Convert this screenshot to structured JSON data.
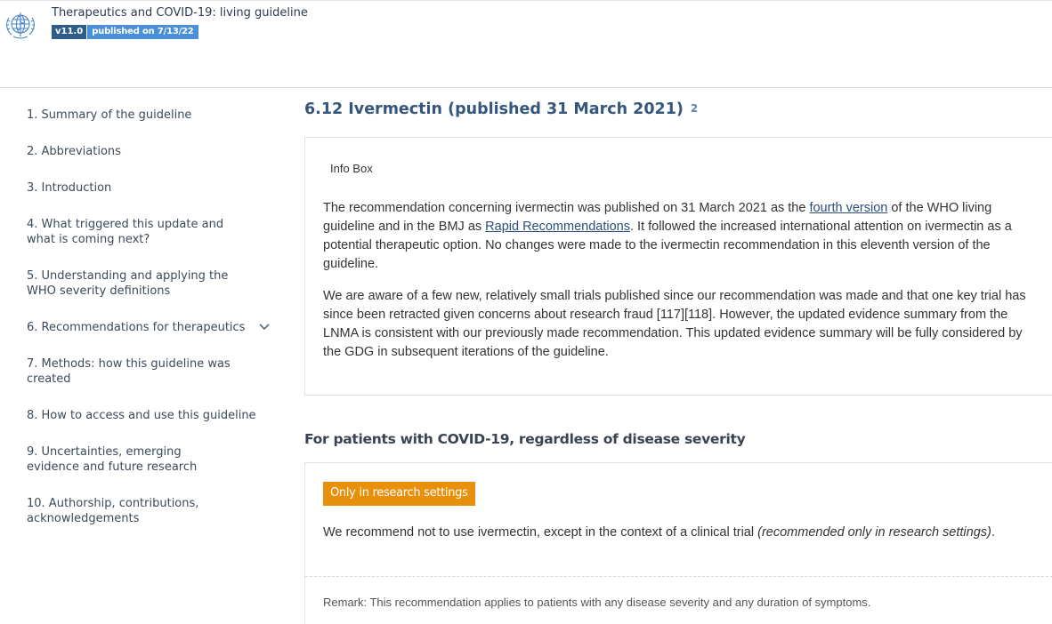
{
  "header": {
    "title": "Therapeutics and COVID-19: living guideline",
    "version": "v11.0",
    "published": "published on 7/13/22",
    "logo_icon": "who-emblem-icon"
  },
  "sidebar": {
    "items": [
      {
        "label": "1. Summary of the guideline"
      },
      {
        "label": "2. Abbreviations"
      },
      {
        "label": "3. Introduction"
      },
      {
        "label": "4. What triggered this update and what is coming next?"
      },
      {
        "label": "5. Understanding and applying the WHO severity definitions"
      },
      {
        "label": "6. Recommendations for therapeutics",
        "icon": "chevron-down-icon"
      },
      {
        "label": "7. Methods: how this guideline was created"
      },
      {
        "label": "8. How to access and use this guideline"
      },
      {
        "label": "9. Uncertainties, emerging evidence and future research"
      },
      {
        "label": "10. Authorship, contributions, acknowledgements"
      }
    ]
  },
  "main": {
    "section_title": "6.12 Ivermectin (published 31 March 2021)",
    "section_count": "2",
    "infobox": {
      "label": "Info Box",
      "p1_a": "The recommendation concerning ivermectin was published on 31 March 2021 as the ",
      "p1_link1": "fourth version",
      "p1_b": " of the WHO living guideline and in the BMJ as ",
      "p1_link2": "Rapid Recommendations",
      "p1_c": ". It followed the increased international attention on ivermectin as a potential therapeutic option. No changes were made to the ivermectin recommendation in this eleventh version of the guideline.",
      "p2": "We are aware of a few new, relatively small trials published since our recommendation was made and that one key trial has since been retracted given concerns about research fraud [117][118]. However, the updated evidence summary from the LNMA is consistent with our previously made recommendation. This updated evidence summary will be fully considered by the GDG in subsequent iterations of the guideline."
    },
    "subheading": "For patients with COVID-19, regardless of disease severity",
    "recommendation": {
      "badge": "Only in research settings",
      "badge_color": "#e8900c",
      "text": "We recommend not to use ivermectin, except in the context of a clinical trial ",
      "text_italic": "(recommended only in research settings)",
      "text_end": ".",
      "remark": "Remark: This recommendation applies to patients with any disease severity and any duration of symptoms."
    }
  }
}
